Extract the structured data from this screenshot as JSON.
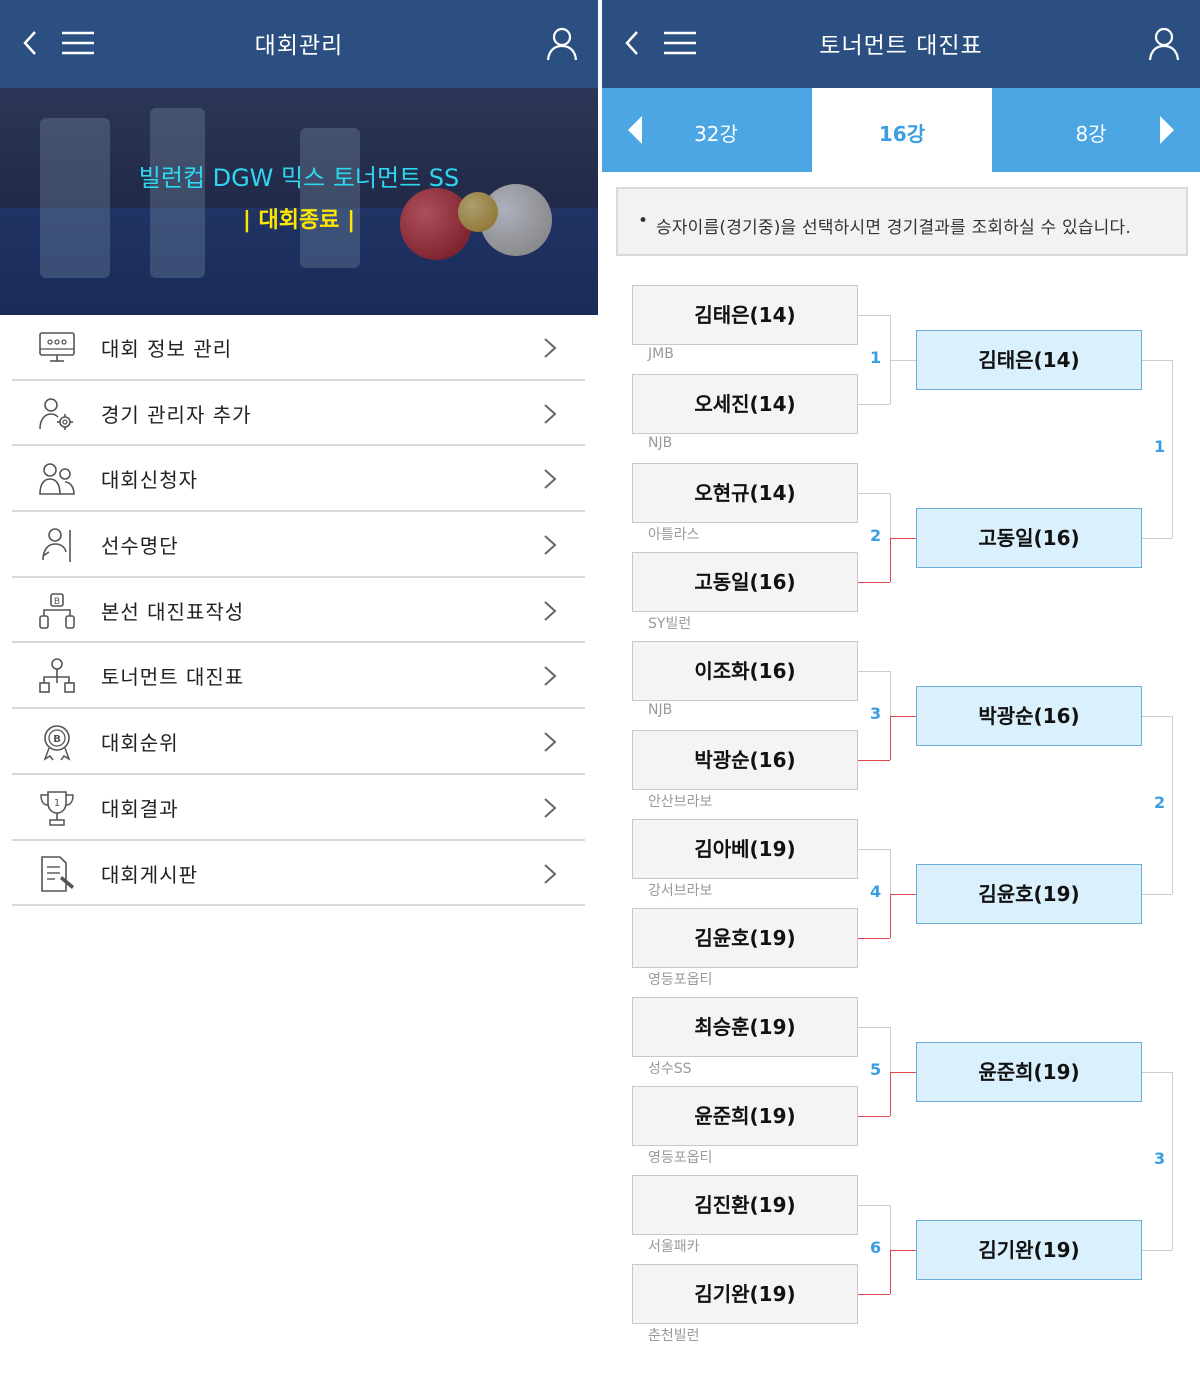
{
  "left_screen": {
    "header": {
      "title": "대회관리",
      "back_icon": "chevron-left-icon",
      "menu_icon": "hamburger-icon",
      "user_icon": "user-icon"
    },
    "banner": {
      "tournament_name": "빌런컵 DGW 믹스 토너먼트 SS",
      "status": "|  대회종료  |"
    },
    "menu": [
      {
        "label": "대회 정보 관리",
        "icon": "monitor-icon"
      },
      {
        "label": "경기 관리자 추가",
        "icon": "user-gear-icon"
      },
      {
        "label": "대회신청자",
        "icon": "users-icon"
      },
      {
        "label": "선수명단",
        "icon": "player-cue-icon"
      },
      {
        "label": "본선 대진표작성",
        "icon": "bracket-create-icon"
      },
      {
        "label": "토너먼트 대진표",
        "icon": "tree-icon"
      },
      {
        "label": "대회순위",
        "icon": "medal-icon"
      },
      {
        "label": "대회결과",
        "icon": "trophy-icon"
      },
      {
        "label": "대회게시판",
        "icon": "board-write-icon"
      }
    ]
  },
  "right_screen": {
    "header": {
      "title": "토너먼트 대진표",
      "back_icon": "chevron-left-icon",
      "menu_icon": "hamburger-icon",
      "user_icon": "user-icon"
    },
    "tabs": {
      "prev": "32강",
      "current": "16강",
      "next": "8강"
    },
    "notice": "승자이름(경기중)을 선택하시면 경기결과를 조회하실 수 있습니다.",
    "colors": {
      "header": "#2c4f82",
      "tab_blue": "#4ba6e3",
      "winner_box": "#daf0fc",
      "winner_line": "#e0474c",
      "match_number": "#3a9ee0"
    },
    "matches": [
      {
        "number": "1",
        "players": [
          {
            "name": "김태은(14)",
            "club": "JMB"
          },
          {
            "name": "오세진(14)",
            "club": "NJB"
          }
        ],
        "winner": "김태은(14)",
        "winner_slot": "top"
      },
      {
        "number": "2",
        "players": [
          {
            "name": "오현규(14)",
            "club": "아틀라스"
          },
          {
            "name": "고동일(16)",
            "club": "SY빌런"
          }
        ],
        "winner": "고동일(16)",
        "winner_slot": "bottom"
      },
      {
        "number": "3",
        "players": [
          {
            "name": "이조화(16)",
            "club": "NJB"
          },
          {
            "name": "박광순(16)",
            "club": "안산브라보"
          }
        ],
        "winner": "박광순(16)",
        "winner_slot": "bottom"
      },
      {
        "number": "4",
        "players": [
          {
            "name": "김아베(19)",
            "club": "강서브라보"
          },
          {
            "name": "김윤호(19)",
            "club": "영등포옵티"
          }
        ],
        "winner": "김윤호(19)",
        "winner_slot": "bottom"
      },
      {
        "number": "5",
        "players": [
          {
            "name": "최승훈(19)",
            "club": "성수SS"
          },
          {
            "name": "윤준희(19)",
            "club": "영등포옵티"
          }
        ],
        "winner": "윤준희(19)",
        "winner_slot": "bottom"
      },
      {
        "number": "6",
        "players": [
          {
            "name": "김진환(19)",
            "club": "서울패카"
          },
          {
            "name": "김기완(19)",
            "club": "춘천빌런"
          }
        ],
        "winner": "김기완(19)",
        "winner_slot": "bottom"
      }
    ],
    "next_round_numbers": [
      "1",
      "2",
      "3"
    ]
  }
}
